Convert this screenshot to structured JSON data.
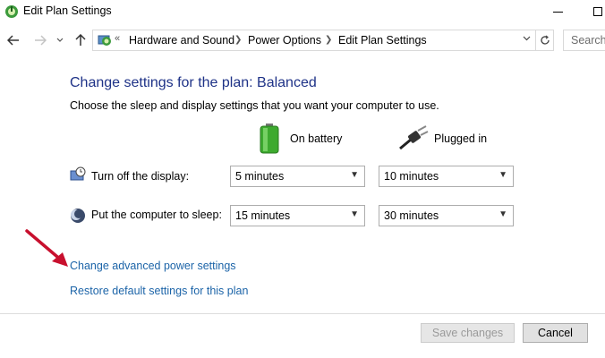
{
  "window": {
    "title": "Edit Plan Settings"
  },
  "nav": {
    "back_icon": "arrow-left-icon",
    "forward_icon": "arrow-right-icon",
    "up_icon": "arrow-up-icon",
    "chevrons": "«",
    "breadcrumbs": [
      "Hardware and Sound",
      "Power Options",
      "Edit Plan Settings"
    ],
    "search_placeholder": "Search"
  },
  "main": {
    "heading": "Change settings for the plan: Balanced",
    "subheading": "Choose the sleep and display settings that you want your computer to use.",
    "columns": {
      "battery": "On battery",
      "plugged": "Plugged in"
    },
    "rows": [
      {
        "label": "Turn off the display:",
        "battery": "5 minutes",
        "plugged": "10 minutes"
      },
      {
        "label": "Put the computer to sleep:",
        "battery": "15 minutes",
        "plugged": "30 minutes"
      }
    ],
    "links": {
      "advanced": "Change advanced power settings",
      "restore": "Restore default settings for this plan"
    }
  },
  "footer": {
    "save": "Save changes",
    "cancel": "Cancel"
  },
  "colors": {
    "heading": "#1e3287",
    "link": "#1c64a8",
    "annotation_arrow": "#c8102e"
  }
}
